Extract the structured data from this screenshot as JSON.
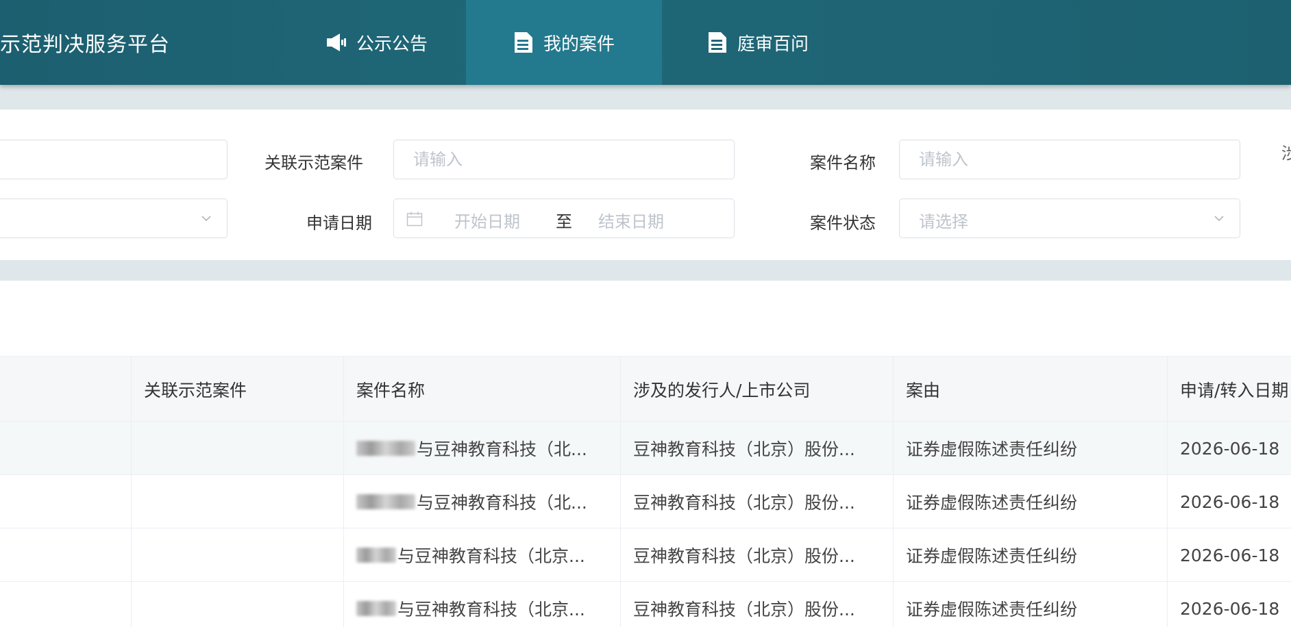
{
  "header": {
    "brand": "示范判决服务平台",
    "nav": [
      {
        "label": "公示公告",
        "icon": "megaphone-icon",
        "active": false
      },
      {
        "label": "我的案件",
        "icon": "document-icon",
        "active": true
      },
      {
        "label": "庭审百问",
        "icon": "document-icon",
        "active": false
      }
    ]
  },
  "filters": {
    "related_case_label": "关联示范案件",
    "related_case_placeholder": "请输入",
    "case_name_label": "案件名称",
    "case_name_placeholder": "请输入",
    "apply_date_label": "申请日期",
    "start_date_placeholder": "开始日期",
    "date_separator": "至",
    "end_date_placeholder": "结束日期",
    "case_status_label": "案件状态",
    "case_status_placeholder": "请选择",
    "truncated_right_label": "涉"
  },
  "table": {
    "columns": [
      "",
      "关联示范案件",
      "案件名称",
      "涉及的发行人/上市公司",
      "案由",
      "申请/转入日期"
    ],
    "rows": [
      {
        "c0": "",
        "related": "",
        "name": "与豆神教育科技（北...",
        "issuer": "豆神教育科技（北京）股份...",
        "cause": "证券虚假陈述责任纠纷",
        "date": "2026-06-18"
      },
      {
        "c0": "",
        "related": "",
        "name": "与豆神教育科技（北...",
        "issuer": "豆神教育科技（北京）股份...",
        "cause": "证券虚假陈述责任纠纷",
        "date": "2026-06-18"
      },
      {
        "c0": "",
        "related": "",
        "name": "与豆神教育科技（北京...",
        "issuer": "豆神教育科技（北京）股份...",
        "cause": "证券虚假陈述责任纠纷",
        "date": "2026-06-18"
      },
      {
        "c0": "",
        "related": "",
        "name": "与豆神教育科技（北京...",
        "issuer": "豆神教育科技（北京）股份...",
        "cause": "证券虚假陈述责任纠纷",
        "date": "2026-06-18"
      }
    ]
  }
}
